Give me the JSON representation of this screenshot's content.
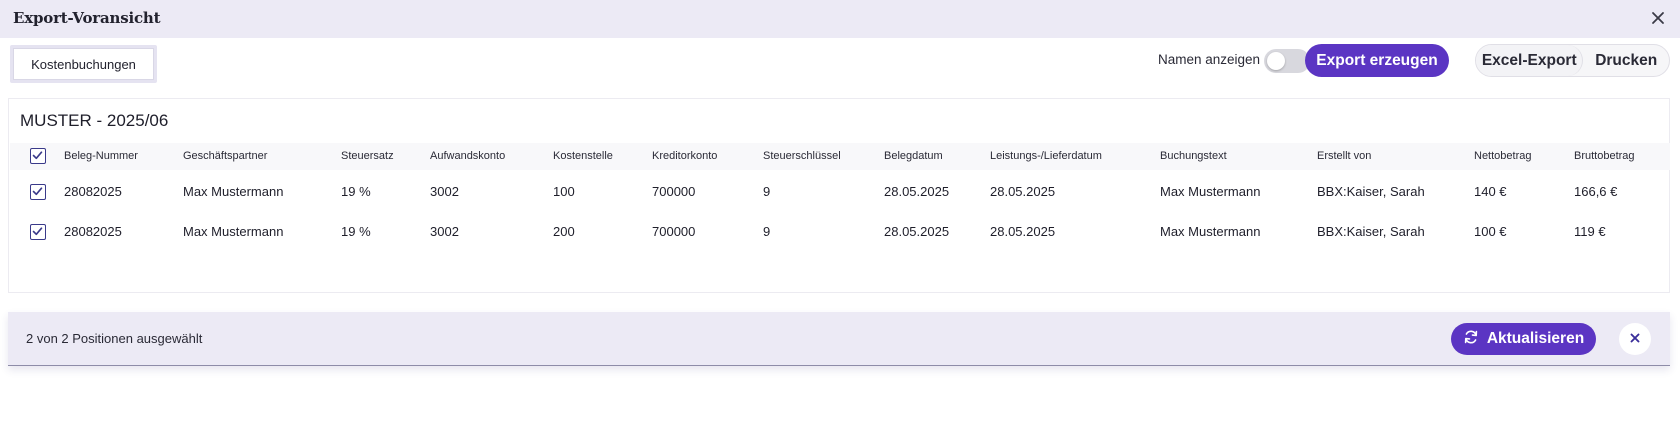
{
  "window": {
    "title": "Export-Voransicht",
    "close_icon": "close-icon"
  },
  "tabs": [
    {
      "label": "Kostenbuchungen",
      "active": true
    }
  ],
  "toolbar": {
    "toggle_label": "Namen anzeigen",
    "toggle_on": false,
    "export_label": "Export erzeugen",
    "excel_label": "Excel-Export",
    "print_label": "Drucken"
  },
  "table": {
    "title": "MUSTER - 2025/06",
    "header_checked": true,
    "columns": [
      "Beleg-Nummer",
      "Geschäftspartner",
      "Steuersatz",
      "Aufwandskonto",
      "Kostenstelle",
      "Kreditorkonto",
      "Steuerschlüssel",
      "Belegdatum",
      "Leistungs-/Lieferdatum",
      "Buchungstext",
      "Erstellt von",
      "Nettobetrag",
      "Bruttobetrag"
    ],
    "rows": [
      {
        "checked": true,
        "cells": [
          "28082025",
          "Max Mustermann",
          "19  %",
          "3002",
          "100",
          "700000",
          "9",
          "28.05.2025",
          "28.05.2025",
          "Max Mustermann",
          "BBX:Kaiser, Sarah",
          "140 €",
          "166,6 €"
        ]
      },
      {
        "checked": true,
        "cells": [
          "28082025",
          "Max Mustermann",
          "19  %",
          "3002",
          "200",
          "700000",
          "9",
          "28.05.2025",
          "28.05.2025",
          "Max Mustermann",
          "BBX:Kaiser, Sarah",
          "100 €",
          "119 €"
        ]
      }
    ]
  },
  "footer": {
    "status": "2 von 2 Positionen ausgewählt",
    "refresh_label": "Aktualisieren",
    "refresh_icon": "refresh-icon",
    "dismiss_icon": "close-icon"
  },
  "colors": {
    "accent": "#5b35c3",
    "header_bg": "#eceaf5",
    "checkbox": "#3a3a8a"
  }
}
